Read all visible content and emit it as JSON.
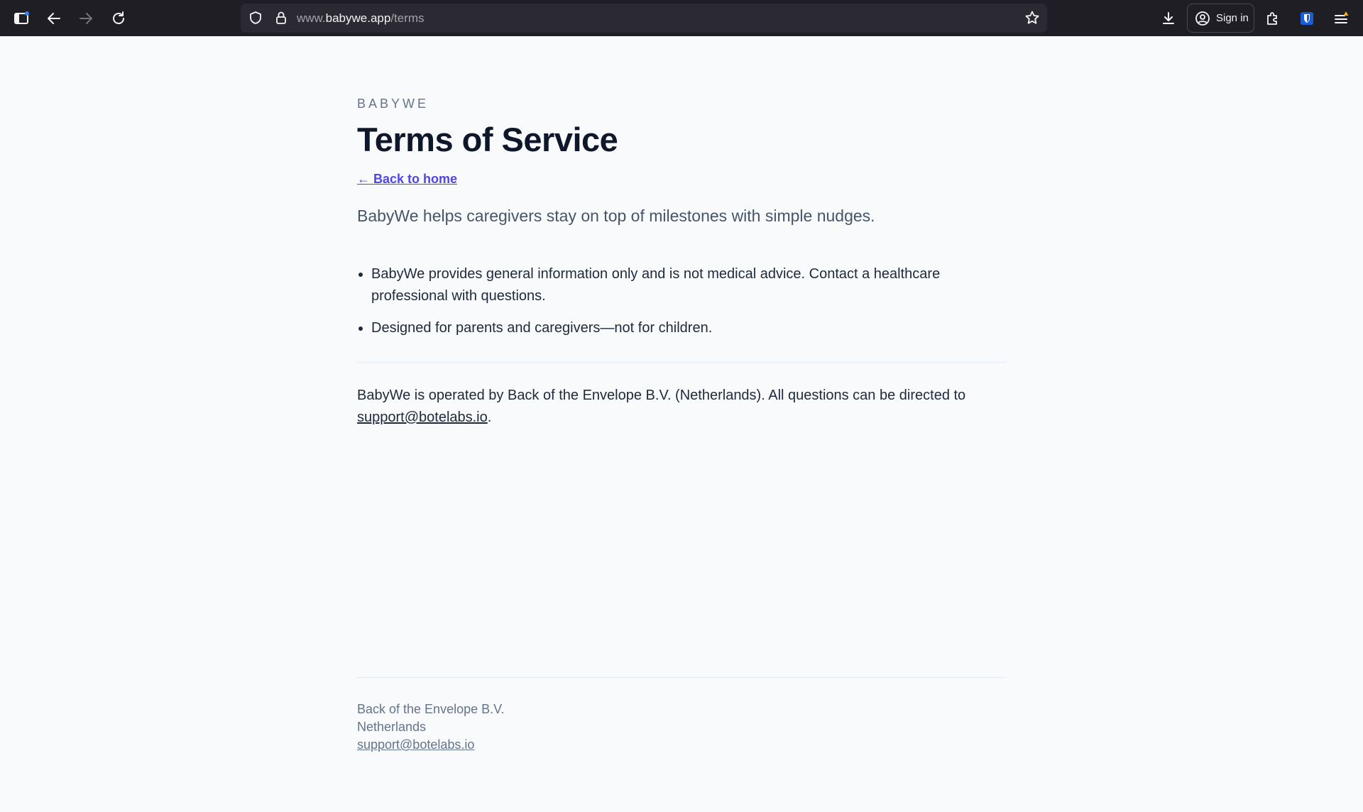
{
  "browser": {
    "url_prefix": "www.",
    "url_host": "babywe.app",
    "url_path": "/terms",
    "sign_in_label": "Sign in",
    "accent_color": "#1f1e25"
  },
  "page": {
    "brand": "BABYWE",
    "title": "Terms of Service",
    "back_link": "← Back to home",
    "tagline": "BabyWe helps caregivers stay on top of milestones with simple nudges.",
    "bullets": [
      "BabyWe provides general information only and is not medical advice. Contact a healthcare professional with questions.",
      "Designed for parents and caregivers—not for children."
    ],
    "operator_text": "BabyWe is operated by Back of the Envelope B.V. (Netherlands). All questions can be directed to ",
    "operator_email": "support@botelabs.io",
    "operator_suffix": ".",
    "link_color": "#4f46e5"
  },
  "footer": {
    "company": "Back of the Envelope B.V.",
    "country": "Netherlands",
    "email": "support@botelabs.io"
  }
}
